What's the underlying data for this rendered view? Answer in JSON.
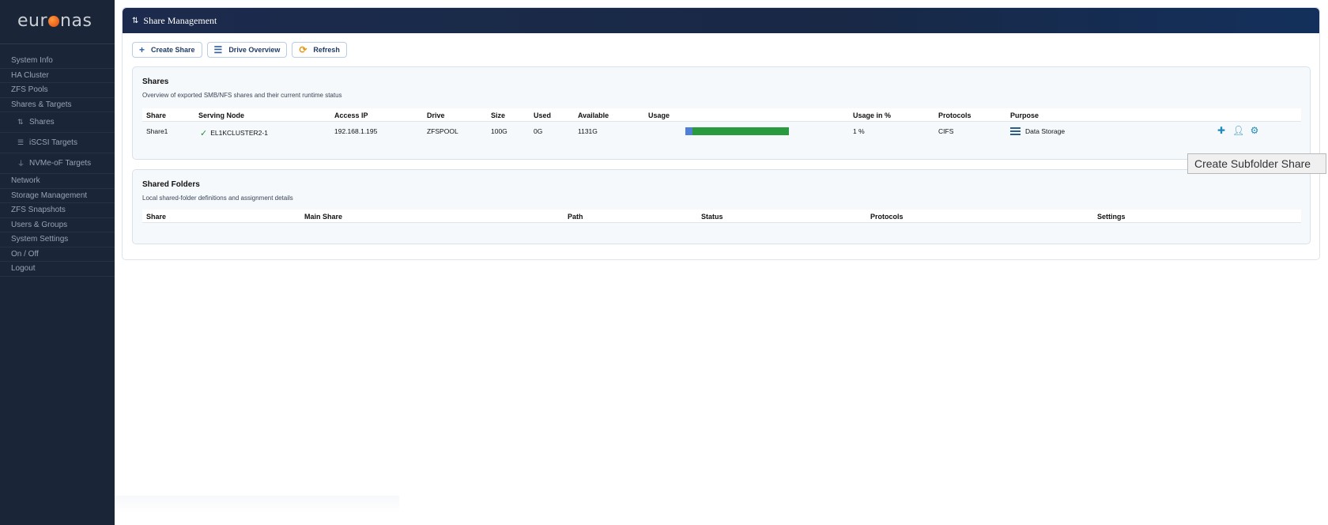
{
  "brand": {
    "part1": "eur",
    "part2": "nas"
  },
  "sidebar": {
    "items_top": [
      "System Info",
      "HA Cluster",
      "ZFS Pools",
      "Shares & Targets"
    ],
    "sub_items": [
      {
        "label": "Shares",
        "icon": "sort-arrows-icon"
      },
      {
        "label": "iSCSI Targets",
        "icon": "stack-icon"
      },
      {
        "label": "NVMe-oF Targets",
        "icon": "plug-icon"
      }
    ],
    "items_bottom": [
      "Network",
      "Storage Management",
      "ZFS Snapshots",
      "Users & Groups",
      "System Settings",
      "On / Off",
      "Logout"
    ]
  },
  "header": {
    "title": "Share  Management"
  },
  "toolbar": {
    "create_share": "Create Share",
    "drive_overview": "Drive Overview",
    "refresh": "Refresh"
  },
  "shares": {
    "title": "Shares",
    "subtitle": "Overview of exported SMB/NFS shares and their current runtime status",
    "columns": [
      "Share",
      "Serving Node",
      "Access IP",
      "Drive",
      "Size",
      "Used",
      "Available",
      "Usage",
      "Usage in %",
      "Protocols",
      "Purpose"
    ],
    "rows": [
      {
        "share": "Share1",
        "serving_node": "EL1KCLUSTER2-1",
        "access_ip": "192.168.1.195",
        "drive": "ZFSPOOL",
        "size": "100G",
        "used": "0G",
        "available": "1131G",
        "usage_fraction": 0.07,
        "usage_pct": "1 %",
        "protocols": "CIFS",
        "purpose": "Data Storage"
      }
    ]
  },
  "shared_folders": {
    "title": "Shared Folders",
    "subtitle": "Local shared-folder definitions and assignment details",
    "columns": [
      "Share",
      "Main Share",
      "Path",
      "Status",
      "Protocols",
      "Settings"
    ]
  },
  "tooltip": "Create Subfolder Share",
  "colors": {
    "sidebar_bg": "#1a2637",
    "header_bg": "#182845",
    "usage_bar": "#2a9a3f",
    "usage_used": "#4f7fd6",
    "action_icon": "#1d8bb8"
  }
}
